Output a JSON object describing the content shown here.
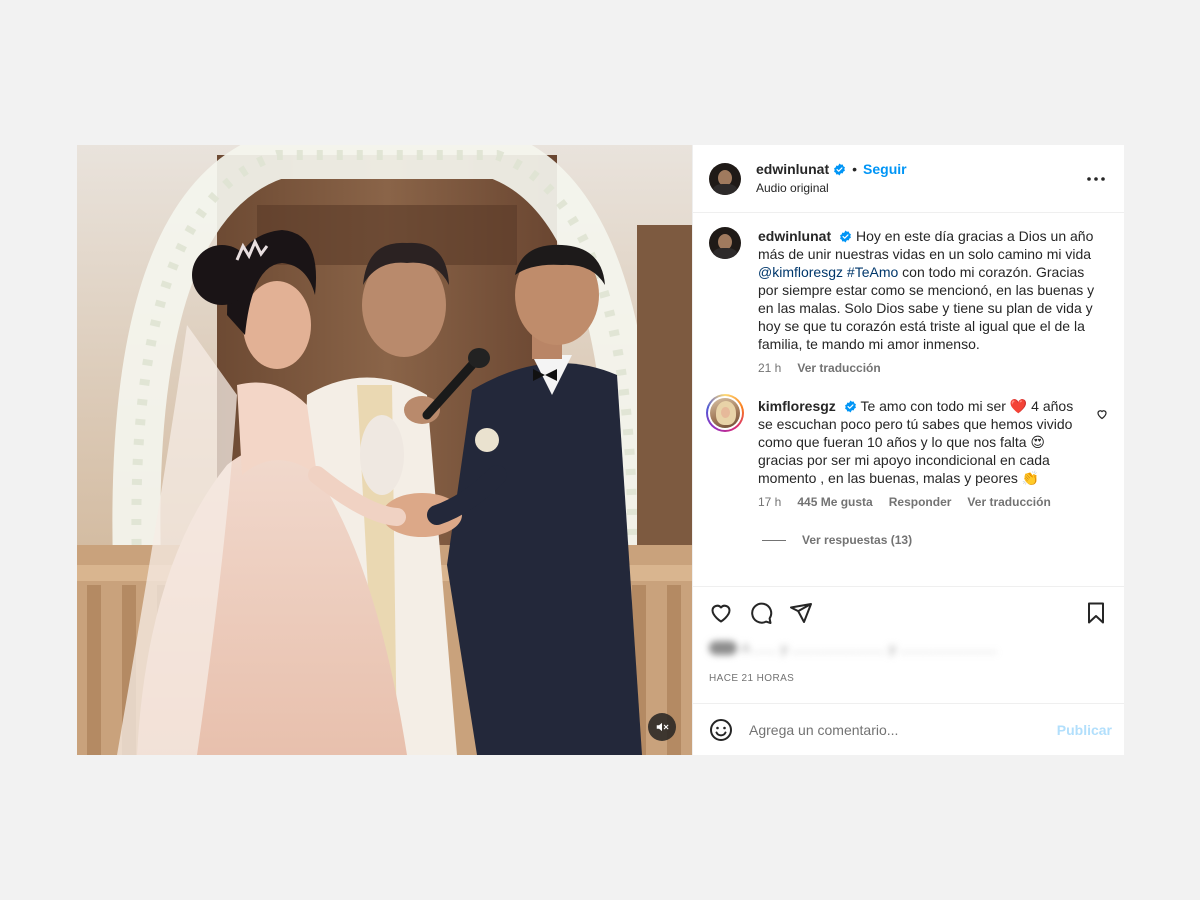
{
  "post": {
    "author": {
      "username": "edwinlunat",
      "verified": true,
      "follow_label": "Seguir",
      "separator": "•",
      "audio_label": "Audio original"
    },
    "media": {
      "type": "video",
      "muted": true,
      "mute_icon": "speaker-muted-icon"
    },
    "caption": {
      "username": "edwinlunat",
      "text_before": "Hoy en este día gracias a Dios un año más de unir nuestras vidas en un solo camino mi vida ",
      "mention": "@kimfloresgz",
      "hashtag": "#TeAmo",
      "text_after": " con todo mi corazón. Gracias por siempre estar como se mencionó, en las buenas y en las malas. Solo Dios sabe y tiene su plan de vida y hoy se que tu corazón está triste al igual que el de la familia, te mando mi amor inmenso.",
      "time": "21 h",
      "translate_label": "Ver traducción"
    },
    "comments": [
      {
        "username": "kimfloresgz",
        "verified": true,
        "text_1": "Te amo con todo mi ser ",
        "emoji_heart": "❤️",
        "text_2": " 4 años se escuchan poco pero tú sabes que hemos vivido como que fueran 10 años y lo que nos falta ",
        "emoji_love": "😍",
        "text_3": " gracias por ser mi apoyo incondicional en cada momento , en las buenas, malas y peores ",
        "emoji_clap": "👏",
        "time": "17 h",
        "likes": "445 Me gusta",
        "reply_label": "Responder",
        "translate_label": "Ver traducción",
        "view_replies_label": "Ver respuestas (13)"
      }
    ],
    "likes_summary_blurred": "A ...... y ........................ y .........................",
    "time_ago": "HACE 21 HORAS",
    "add_comment": {
      "placeholder": "Agrega un comentario...",
      "publish_label": "Publicar"
    }
  },
  "colors": {
    "background": "#f2f2f2",
    "accent_blue": "#0095f6",
    "link_blue": "#00376b",
    "publish_disabled": "#b2dffc",
    "verified_blue": "#0095f6"
  }
}
